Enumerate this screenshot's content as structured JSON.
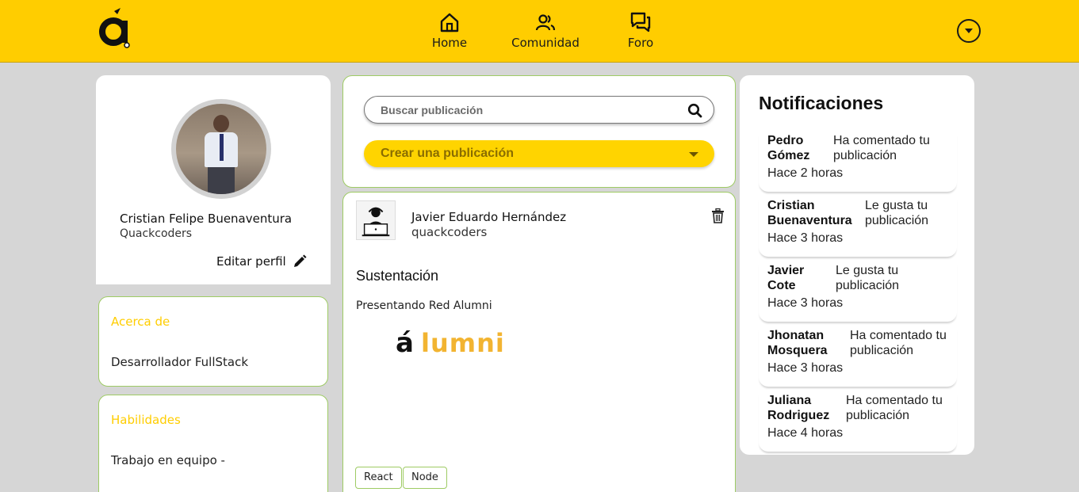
{
  "app": {
    "logo_alt": "á"
  },
  "nav": {
    "items": [
      {
        "label": "Home",
        "icon": "home-icon"
      },
      {
        "label": "Comunidad",
        "icon": "community-icon"
      },
      {
        "label": "Foro",
        "icon": "forum-icon"
      }
    ],
    "account_icon": "caret-down-icon"
  },
  "profile": {
    "name": "Cristian Felipe Buenaventura",
    "organization": "Quackcoders",
    "edit_label": "Editar perfil"
  },
  "about": {
    "title": "Acerca de",
    "text": "Desarrollador FullStack"
  },
  "skills": {
    "title": "Habilidades",
    "text": "Trabajo en equipo -"
  },
  "search": {
    "placeholder": "Buscar publicación",
    "value": ""
  },
  "create_post": {
    "label": "Crear una publicación"
  },
  "post": {
    "author": "Javier Eduardo Hernández",
    "organization": "quackcoders",
    "title": "Sustentación",
    "body": "Presentando Red Alumni",
    "image_logo_a": "á",
    "image_logo_rest": "lumni",
    "tags": [
      "React",
      "Node"
    ]
  },
  "notifications": {
    "title": "Notificaciones",
    "items": [
      {
        "name": "Pedro Gómez",
        "message": "Ha comentado tu publicación",
        "time": "Hace 2 horas"
      },
      {
        "name": "Cristian Buenaventura",
        "message": "Le gusta tu publicación",
        "time": "Hace 3 horas"
      },
      {
        "name": "Javier Cote",
        "message": "Le gusta tu publicación",
        "time": "Hace 3 horas"
      },
      {
        "name": "Jhonatan Mosquera",
        "message": "Ha comentado tu publicación",
        "time": "Hace 3 horas"
      },
      {
        "name": "Juliana Rodriguez",
        "message": "Ha comentado tu publicación",
        "time": "Hace 4 horas"
      }
    ]
  },
  "colors": {
    "brand_yellow": "#ffcd00",
    "accent_green": "#9ecb64",
    "background": "#d6d6d6"
  }
}
